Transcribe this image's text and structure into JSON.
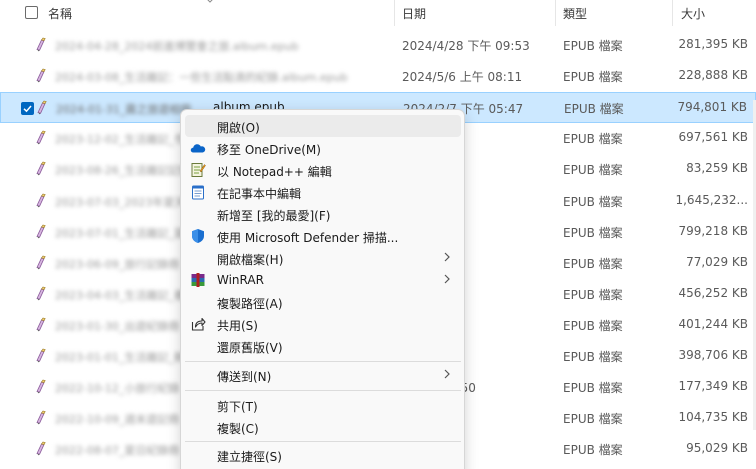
{
  "header": {
    "name": "名稱",
    "date": "日期",
    "type": "類型",
    "size": "大小"
  },
  "files": [
    {
      "name": "2024-04-28_2024前進博覽會之旅.album.epub",
      "date": "2024/4/28 下午 09:53",
      "type": "EPUB 檔案",
      "size": "281,395 KB",
      "selected": false
    },
    {
      "name": "2024-03-08_生活雜記：一些生活點滴的紀錄.album.epub",
      "date": "2024/5/6 上午 08:11",
      "type": "EPUB 檔案",
      "size": "228,888 KB",
      "selected": false
    },
    {
      "name": "2024-01-31_霧之旅遊相冊",
      "ext": "album.epub",
      "date": "2024/2/7 下午 05:47",
      "type": "EPUB 檔案",
      "size": "794,801 KB",
      "selected": true
    },
    {
      "name": "2023-12-02_生活雜記_冬日",
      "date": "下午 08:46",
      "type": "EPUB 檔案",
      "size": "697,561 KB",
      "selected": false
    },
    {
      "name": "2023-08-26_生活雜記記錄",
      "date": "下午 03:26",
      "type": "EPUB 檔案",
      "size": "83,259 KB",
      "selected": false
    },
    {
      "name": "2023-07-03_2023年夏天",
      "date": "下午 12:32",
      "type": "EPUB 檔案",
      "size": "1,645,232...",
      "selected": false
    },
    {
      "name": "2023-07-01_生活雜記_夏",
      "date": "上午 08:14",
      "type": "EPUB 檔案",
      "size": "799,218 KB",
      "selected": false
    },
    {
      "name": "2023-06-09_旅行記錄冊",
      "date": "下午 03:00",
      "type": "EPUB 檔案",
      "size": "77,029 KB",
      "selected": false
    },
    {
      "name": "2023-04-03_生活雜記_春",
      "date": "下午 12:12",
      "type": "EPUB 檔案",
      "size": "456,252 KB",
      "selected": false
    },
    {
      "name": "2023-01-30_出遊紀錄冊",
      "date": "下午 07:56",
      "type": "EPUB 檔案",
      "size": "401,244 KB",
      "selected": false
    },
    {
      "name": "2023-01-01_生活雜記_新",
      "date": "下午 03:52",
      "type": "EPUB 檔案",
      "size": "398,706 KB",
      "selected": false
    },
    {
      "name": "2022-10-12_小旅行紀錄",
      "date": "5 上午 11:50",
      "type": "EPUB 檔案",
      "size": "177,349 KB",
      "selected": false
    },
    {
      "name": "2022-10-09_週末遊記冊",
      "date": "下午 12:55",
      "type": "EPUB 檔案",
      "size": "104,735 KB",
      "selected": false
    },
    {
      "name": "2022-08-07_夏日紀錄冊",
      "date": "下午 05:29",
      "type": "EPUB 檔案",
      "size": "95,029 KB",
      "selected": false
    }
  ],
  "menu": {
    "items": [
      {
        "label": "開啟(O)",
        "icon": "none",
        "highlighted": true
      },
      {
        "label": "移至 OneDrive(M)",
        "icon": "onedrive-icon"
      },
      {
        "label": "以 Notepad++ 編輯",
        "icon": "notepadpp-icon"
      },
      {
        "label": "在記事本中編輯",
        "icon": "notepad-icon"
      },
      {
        "label": "新增至 [我的最愛](F)",
        "icon": "none"
      },
      {
        "label": "使用 Microsoft Defender 掃描...",
        "icon": "defender-icon"
      },
      {
        "label": "開啟檔案(H)",
        "icon": "none",
        "submenu": true
      },
      {
        "label": "WinRAR",
        "icon": "winrar-icon",
        "submenu": true
      },
      {
        "label": "複製路徑(A)",
        "icon": "none"
      },
      {
        "label": "共用(S)",
        "icon": "share-icon"
      },
      {
        "label": "還原舊版(V)",
        "icon": "none"
      },
      {
        "label": "傳送到(N)",
        "icon": "none",
        "submenu": true
      },
      {
        "label": "剪下(T)",
        "icon": "none"
      },
      {
        "label": "複製(C)",
        "icon": "none"
      },
      {
        "label": "建立捷徑(S)",
        "icon": "none"
      }
    ]
  },
  "colors": {
    "selection_bg": "#cce8ff",
    "selection_border": "#99d1ff",
    "accent": "#0067c0",
    "menu_bg": "#f9f9f9",
    "menu_highlight": "#ebebeb"
  }
}
